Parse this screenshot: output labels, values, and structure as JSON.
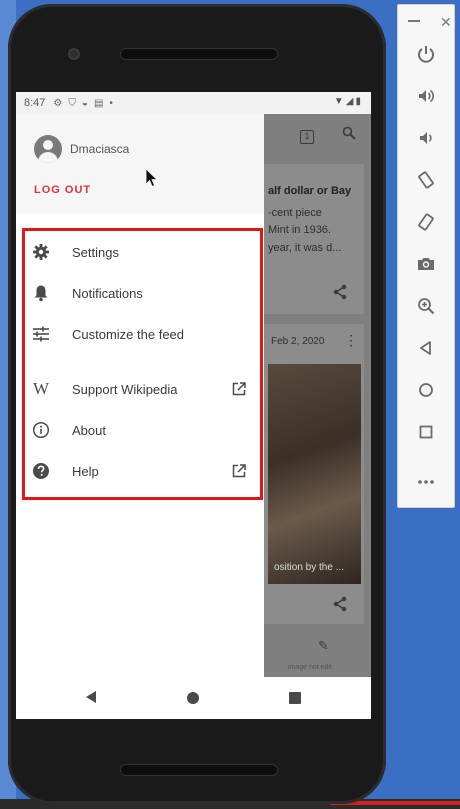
{
  "status_bar": {
    "time": "8:47"
  },
  "drawer": {
    "username": "Dmaciasca",
    "logout_label": "LOG OUT",
    "items": [
      {
        "label": "Settings",
        "icon": "gear-icon"
      },
      {
        "label": "Notifications",
        "icon": "bell-icon"
      },
      {
        "label": "Customize the feed",
        "icon": "sliders-icon"
      },
      {
        "label": "Support Wikipedia",
        "icon": "wikipedia-w-icon",
        "external": true
      },
      {
        "label": "About",
        "icon": "info-icon"
      },
      {
        "label": "Help",
        "icon": "help-icon",
        "external": true
      }
    ]
  },
  "background_feed": {
    "tab_count": "1",
    "card1_line1": "alf dollar or Bay",
    "card1_line2": "-cent piece",
    "card1_line3": "Mint in 1936.",
    "card1_line4": "year, it was d...",
    "card2_date": "Feb 2, 2020",
    "card2_caption": "osition by the ...",
    "edit_label": "image not edit"
  },
  "colors": {
    "accent_red": "#d33333",
    "highlight": "#e11818"
  }
}
